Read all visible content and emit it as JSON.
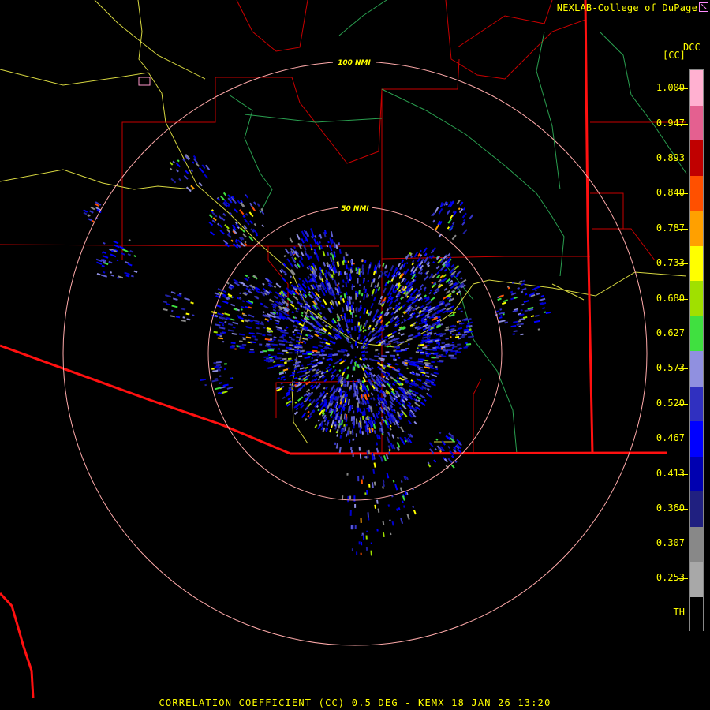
{
  "credit": "NEXLAB-College of DuPage",
  "credit_icon": "external-link-icon",
  "product_code": "DCC",
  "unit": "[CC]",
  "range_rings": [
    "100 NMI",
    "50 NMI"
  ],
  "legend": {
    "ticks": [
      "1.000",
      "0.947",
      "0.893",
      "0.840",
      "0.787",
      "0.733",
      "0.680",
      "0.627",
      "0.573",
      "0.520",
      "0.467",
      "0.413",
      "0.360",
      "0.307",
      "0.253",
      "TH"
    ],
    "colors": [
      "#ffb0d0",
      "#e46090",
      "#c00000",
      "#ff5000",
      "#ffa000",
      "#ffff00",
      "#a0e000",
      "#40e040",
      "#9090e0",
      "#3030c0",
      "#0000ff",
      "#0000b0",
      "#202080",
      "#888888",
      "#a8a8a8",
      "#000000"
    ]
  },
  "footer": "CORRELATION COEFFICIENT (CC) 0.5 DEG - KEMX 18 JAN 26 13:20"
}
